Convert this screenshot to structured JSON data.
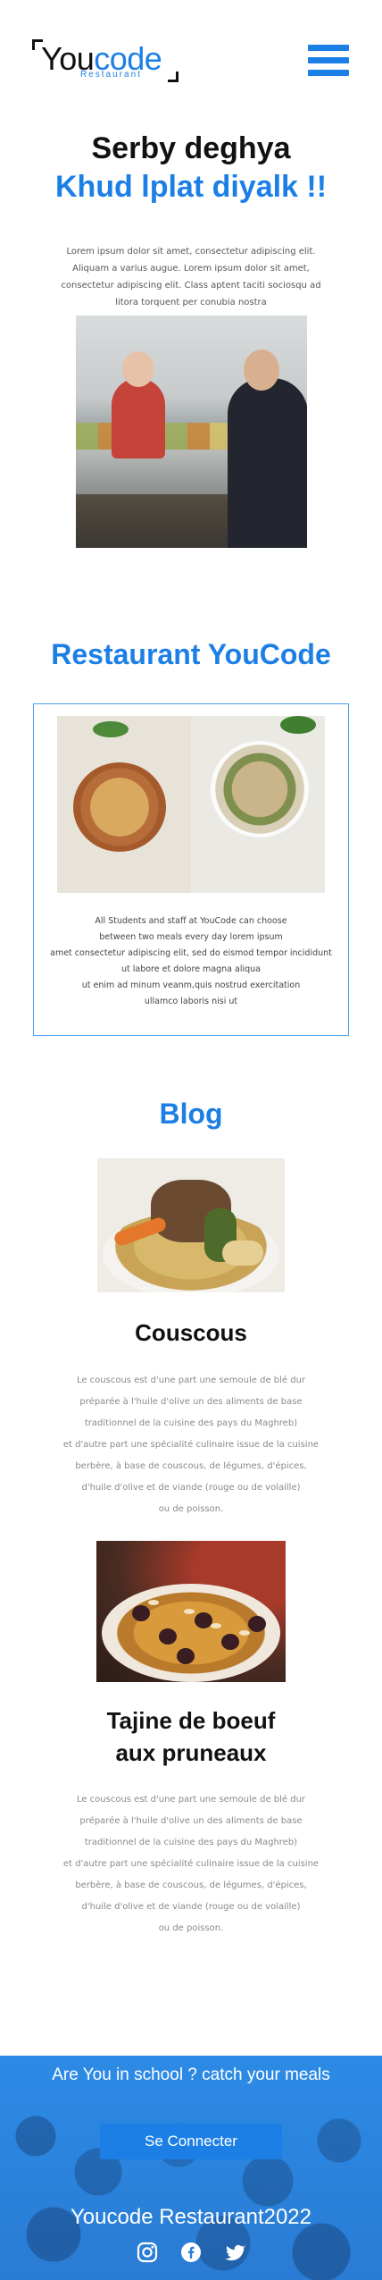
{
  "header": {
    "logo": {
      "primary_you": "You",
      "primary_code": "code",
      "subtitle": "Restaurant"
    },
    "menu_icon": "hamburger-menu-icon"
  },
  "hero": {
    "title_line1": "Serby deghya",
    "title_line2": "Khud lplat diyalk !!",
    "paragraph": "Lorem ipsum dolor sit amet, consectetur adipiscing elit. Aliquam a varius augue. Lorem ipsum dolor sit amet, consectetur adipiscing elit. Class aptent taciti sociosqu ad litora torquent per conubia nostra"
  },
  "restaurant": {
    "title": "Restaurant YouCode",
    "text_lines": [
      "All Students and staff at YouCode can choose",
      "between two meals every day lorem ipsum",
      "amet consectetur adipiscing elit, sed do eismod tempor incididunt",
      "ut labore et dolore magna aliqua",
      "ut enim ad minum veanm,quis nostrud exercitation",
      "ullamco laboris nisi ut"
    ]
  },
  "blog": {
    "title": "Blog",
    "posts": [
      {
        "title": "Couscous",
        "text_lines": [
          "Le couscous est d'une part une semoule de blé dur",
          "préparée à l'huile d'olive  un des aliments de base",
          "traditionnel de la cuisine des pays du Maghreb)",
          "et d'autre part une spécialité culinaire issue de la cuisine",
          "berbère, à base de couscous, de légumes, d'épices,",
          "d'huile d'olive et de viande (rouge ou de volaille)",
          "ou de poisson."
        ]
      },
      {
        "title_line1": "Tajine de boeuf",
        "title_line2": "aux pruneaux",
        "text_lines": [
          "Le couscous est d'une part une semoule de blé dur",
          "préparée à l'huile d'olive  un des aliments de base",
          "traditionnel de la cuisine des pays du Maghreb)",
          "et d'autre part une spécialité culinaire issue de la cuisine",
          "berbère, à base de couscous, de légumes, d'épices,",
          "d'huile d'olive et de viande (rouge ou de volaille)",
          "ou de poisson."
        ]
      }
    ]
  },
  "footer": {
    "tagline": "Are You in school ? catch your meals",
    "cta_label": "Se Connecter",
    "brand": "Youcode Restaurant2022",
    "socials": [
      "instagram-icon",
      "facebook-icon",
      "twitter-icon"
    ]
  },
  "colors": {
    "accent": "#1c7fe6",
    "text": "#111111",
    "muted": "#8a8a8a",
    "footer_bg": "#2a85e0"
  }
}
